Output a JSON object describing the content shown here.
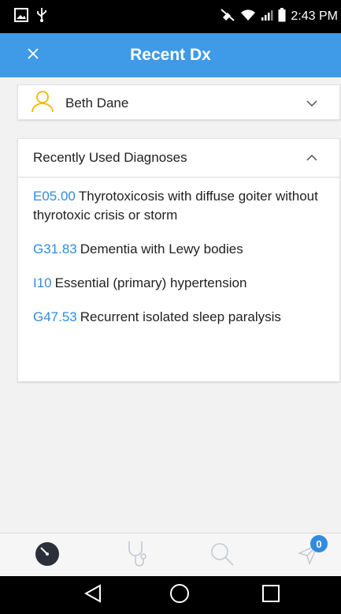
{
  "status_bar": {
    "time": "2:43 PM"
  },
  "app_bar": {
    "title": "Recent Dx"
  },
  "patient": {
    "name": "Beth Dane"
  },
  "recent": {
    "header": "Recently Used Diagnoses",
    "items": [
      {
        "code": "E05.00",
        "description": "Thyrotoxicosis with diffuse goiter without thyrotoxic crisis or storm"
      },
      {
        "code": "G31.83",
        "description": "Dementia with Lewy bodies"
      },
      {
        "code": "I10",
        "description": "Essential (primary) hypertension"
      },
      {
        "code": "G47.53",
        "description": "Recurrent isolated sleep paralysis"
      }
    ]
  },
  "tabs": {
    "outbox_badge": "0"
  },
  "colors": {
    "app_bar": "#3f9ae8",
    "accent": "#2f8ce0",
    "avatar": "#f5b800"
  },
  "icons": [
    "image-icon",
    "usb-icon",
    "mute-icon",
    "wifi-icon",
    "signal-icon",
    "battery-icon",
    "close-icon",
    "person-icon",
    "chevron-down-icon",
    "chevron-up-icon",
    "timer-icon",
    "stethoscope-icon",
    "search-icon",
    "send-icon",
    "back-icon",
    "home-icon",
    "recents-icon"
  ]
}
